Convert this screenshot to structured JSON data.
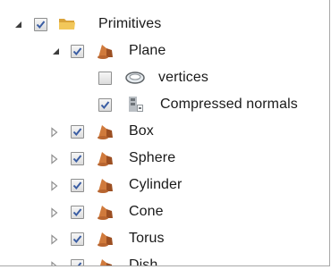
{
  "tree": {
    "root": {
      "label": "Primitives",
      "expanded": true,
      "checked": true,
      "icon": "folder-icon"
    },
    "plane": {
      "label": "Plane",
      "expanded": true,
      "checked": true,
      "icon": "object-icon"
    },
    "plane_children": [
      {
        "label": "vertices",
        "checked": false,
        "icon": "vertices-icon"
      },
      {
        "label": "Compressed normals",
        "checked": true,
        "icon": "compressed-normals-icon"
      }
    ],
    "siblings": [
      {
        "label": "Box",
        "expanded": false,
        "checked": true,
        "icon": "object-icon"
      },
      {
        "label": "Sphere",
        "expanded": false,
        "checked": true,
        "icon": "object-icon"
      },
      {
        "label": "Cylinder",
        "expanded": false,
        "checked": true,
        "icon": "object-icon"
      },
      {
        "label": "Cone",
        "expanded": false,
        "checked": true,
        "icon": "object-icon"
      },
      {
        "label": "Torus",
        "expanded": false,
        "checked": true,
        "icon": "object-icon"
      },
      {
        "label": "Dish",
        "expanded": false,
        "checked": true,
        "icon": "object-icon"
      }
    ]
  },
  "colors": {
    "checkmark": "#3a5da3",
    "object_icon": "#c8743a",
    "folder_icon": "#e8b84a",
    "expander_expanded": "#3d3d3d",
    "expander_collapsed": "#909090"
  }
}
